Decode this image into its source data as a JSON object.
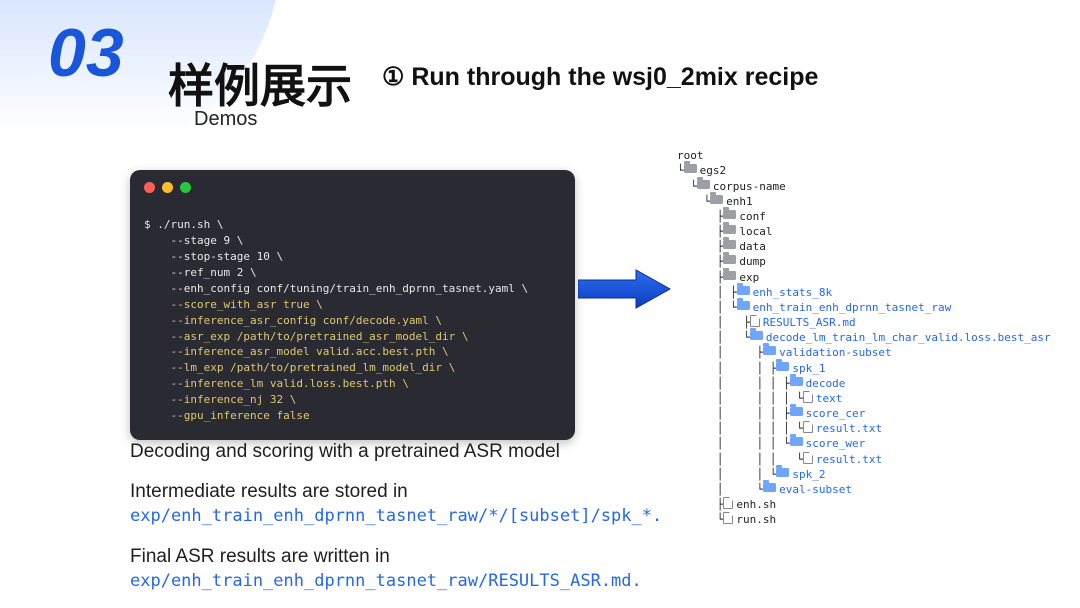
{
  "slide": {
    "number": "03",
    "title_zh": "样例展示",
    "subtitle_en": "Demos"
  },
  "step": {
    "label": "① Run through the wsj0_2mix recipe"
  },
  "terminal": {
    "line1": "$ ./run.sh \\",
    "line2": "    --stage 9 \\",
    "line3": "    --stop-stage 10 \\",
    "line4": "    --ref_num 2 \\",
    "line5": "    --enh_config conf/tuning/train_enh_dprnn_tasnet.yaml \\",
    "line6": "    --score_with_asr true \\",
    "line7": "    --inference_asr_config conf/decode.yaml \\",
    "line8": "    --asr_exp /path/to/pretrained_asr_model_dir \\",
    "line9": "    --inference_asr_model valid.acc.best.pth \\",
    "line10": "    --lm_exp /path/to/pretrained_lm_model_dir \\",
    "line11": "    --inference_lm valid.loss.best.pth \\",
    "line12": "    --inference_nj 32 \\",
    "line13": "    --gpu_inference false"
  },
  "desc": {
    "decoding": "Decoding and scoring with a pretrained ASR model",
    "intermediate": "Intermediate results are stored in",
    "intermediate_path": "exp/enh_train_enh_dprnn_tasnet_raw/*/[subset]/spk_*",
    "final": "Final ASR results are written in",
    "final_path": "exp/enh_train_enh_dprnn_tasnet_raw/RESULTS_ASR.md"
  },
  "tree": {
    "root": "root",
    "egs2": "egs2",
    "corpus": "corpus-name",
    "enh1": "enh1",
    "conf": "conf",
    "local": "local",
    "data": "data",
    "dump": "dump",
    "exp": "exp",
    "enh_stats": "enh_stats_8k",
    "enh_train": "enh_train_enh_dprnn_tasnet_raw",
    "results_asr": "RESULTS_ASR.md",
    "decode_lm": "decode_lm_train_lm_char_valid.loss.best_asr",
    "validation_subset": "validation-subset",
    "spk1": "spk_1",
    "decode": "decode",
    "text": "text",
    "score_cer": "score_cer",
    "result_txt1": "result.txt",
    "score_wer": "score_wer",
    "result_txt2": "result.txt",
    "spk2": "spk_2",
    "eval_subset": "eval-subset",
    "enh_sh": "enh.sh",
    "run_sh": "run.sh"
  }
}
